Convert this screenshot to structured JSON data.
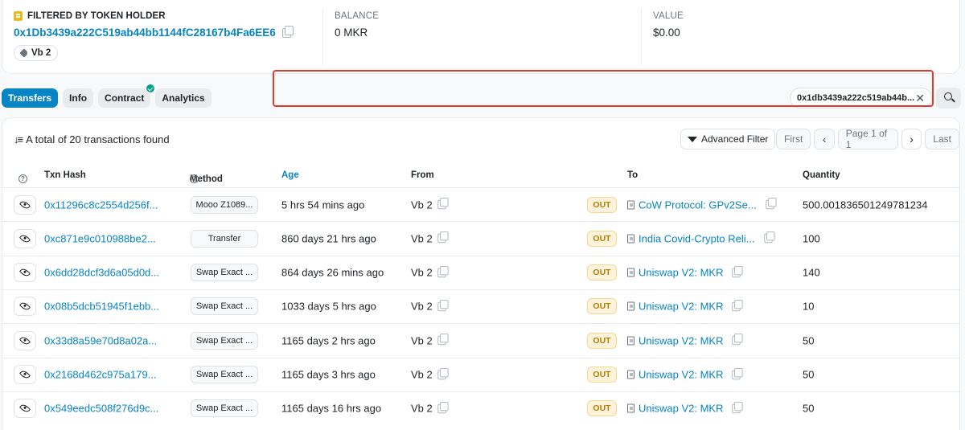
{
  "summary": {
    "holder_title": "FILTERED BY TOKEN HOLDER",
    "holder_address": "0x1Db3439a222C519ab44bb1144fC28167b4Fa6EE6",
    "holder_tag": "Vb 2",
    "balance_label": "BALANCE",
    "balance_value": "0 MKR",
    "value_label": "VALUE",
    "value_value": "$0.00"
  },
  "tabs": [
    {
      "label": "Transfers",
      "active": true
    },
    {
      "label": "Info"
    },
    {
      "label": "Contract",
      "verified": true
    },
    {
      "label": "Analytics"
    }
  ],
  "filter_chip": "0x1db3439a222c519ab44b...",
  "toolbar": {
    "total": "A total of 20 transactions found",
    "advanced_filter": "Advanced Filter",
    "first": "First",
    "page": "Page 1 of 1",
    "last": "Last"
  },
  "columns": {
    "txn_hash": "Txn Hash",
    "method": "Method",
    "age": "Age",
    "from": "From",
    "to": "To",
    "quantity": "Quantity"
  },
  "rows": [
    {
      "hash": "0x11296c8c2554d256f...",
      "method": "Mooo Z1089...",
      "age": "5 hrs 54 mins ago",
      "from": "Vb 2",
      "dir": "OUT",
      "to": "CoW Protocol: GPv2Se...",
      "qty": "500.001836501249781234"
    },
    {
      "hash": "0xc871e9c010988be2...",
      "method": "Transfer",
      "age": "860 days 21 hrs ago",
      "from": "Vb 2",
      "dir": "OUT",
      "to": "India Covid-Crypto Reli...",
      "qty": "100"
    },
    {
      "hash": "0x6dd28dcf3d6a05d0d...",
      "method": "Swap Exact ...",
      "age": "864 days 26 mins ago",
      "from": "Vb 2",
      "dir": "OUT",
      "to": "Uniswap V2: MKR",
      "qty": "140"
    },
    {
      "hash": "0x08b5dcb51945f1ebb...",
      "method": "Swap Exact ...",
      "age": "1033 days 5 hrs ago",
      "from": "Vb 2",
      "dir": "OUT",
      "to": "Uniswap V2: MKR",
      "qty": "10"
    },
    {
      "hash": "0x33d8a59e70d8a02a...",
      "method": "Swap Exact ...",
      "age": "1165 days 2 hrs ago",
      "from": "Vb 2",
      "dir": "OUT",
      "to": "Uniswap V2: MKR",
      "qty": "50"
    },
    {
      "hash": "0x2168d462c975a179...",
      "method": "Swap Exact ...",
      "age": "1165 days 3 hrs ago",
      "from": "Vb 2",
      "dir": "OUT",
      "to": "Uniswap V2: MKR",
      "qty": "50"
    },
    {
      "hash": "0x549eedc508f276d9c...",
      "method": "Swap Exact ...",
      "age": "1165 days 16 hrs ago",
      "from": "Vb 2",
      "dir": "OUT",
      "to": "Uniswap V2: MKR",
      "qty": "50"
    }
  ]
}
